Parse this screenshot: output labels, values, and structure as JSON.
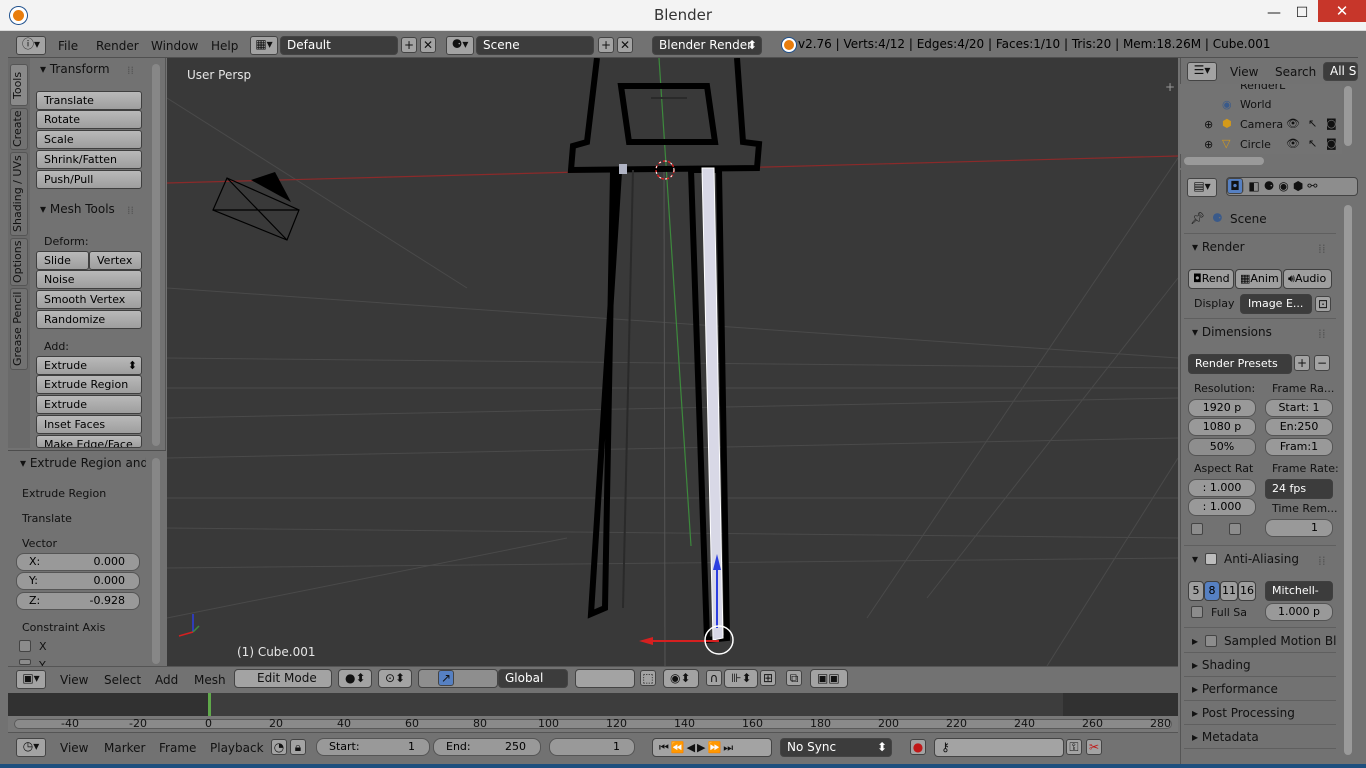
{
  "window": {
    "title": "Blender",
    "min": "—",
    "max": "☐",
    "close": "✕"
  },
  "menubar": {
    "items": [
      "File",
      "Render",
      "Window",
      "Help"
    ]
  },
  "screen_layout": "Default",
  "scene_name": "Scene",
  "render_engine": "Blender Render",
  "stats": "v2.76 | Verts:4/12 | Edges:4/20 | Faces:1/10 | Tris:20 | Mem:18.26M | Cube.001",
  "shelf_tabs": [
    "Tools",
    "Create",
    "Shading / UVs",
    "Options",
    "Grease Pencil"
  ],
  "transform": {
    "header": "Transform",
    "buttons": [
      "Translate",
      "Rotate",
      "Scale",
      "Shrink/Fatten",
      "Push/Pull"
    ]
  },
  "mesh_tools": {
    "header": "Mesh Tools",
    "deform_label": "Deform:",
    "slide_edge": "Slide Ed",
    "vertex": "Vertex",
    "deform_buttons": [
      "Noise",
      "Smooth Vertex",
      "Randomize"
    ],
    "add_label": "Add:",
    "extrude": "Extrude",
    "add_buttons": [
      "Extrude Region",
      "Extrude Individual",
      "Inset Faces",
      "Make Edge/Face"
    ]
  },
  "operator": {
    "header": "Extrude Region and",
    "lines": [
      "Extrude Region",
      "Translate"
    ],
    "vector_label": "Vector",
    "vector": [
      {
        "k": "X:",
        "v": "0.000"
      },
      {
        "k": "Y:",
        "v": "0.000"
      },
      {
        "k": "Z:",
        "v": "-0.928"
      }
    ],
    "constraint_label": "Constraint Axis",
    "axes": [
      "X",
      "Y"
    ]
  },
  "viewport": {
    "label": "User Persp",
    "object": "(1) Cube.001"
  },
  "vp_header": {
    "menus": [
      "View",
      "Select",
      "Add",
      "Mesh"
    ],
    "mode": "Edit Mode",
    "orientation": "Global"
  },
  "timeline": {
    "ticks": [
      "-40",
      "-20",
      "0",
      "20",
      "40",
      "60",
      "80",
      "100",
      "120",
      "140",
      "160",
      "180",
      "200",
      "220",
      "240",
      "260",
      "280"
    ]
  },
  "timeline_header": {
    "menus": [
      "View",
      "Marker",
      "Frame",
      "Playback"
    ],
    "start_label": "Start:",
    "start": "1",
    "end_label": "End:",
    "end": "250",
    "current": "1",
    "sync": "No Sync"
  },
  "outliner": {
    "menus": [
      "View",
      "Search"
    ],
    "filter": "All Sc",
    "items": [
      "RenderL",
      "World",
      "Camera",
      "Circle"
    ]
  },
  "properties": {
    "context": "Scene",
    "render_header": "Render",
    "render_buttons": [
      "Rend",
      "Anim",
      "Audio"
    ],
    "display_label": "Display",
    "display_value": "Image E...",
    "dimensions_header": "Dimensions",
    "presets": "Render Presets",
    "resolution_label": "Resolution:",
    "res_x": "1920 p",
    "res_y": "1080 p",
    "res_pct": "50%",
    "frame_range_label": "Frame Ra...",
    "frame_start": "Start: 1",
    "frame_end": "En:250",
    "frame_step": "Fram:1",
    "aspect_label": "Aspect Rat",
    "aspect_x": ": 1.000",
    "aspect_y": ": 1.000",
    "frame_rate_label": "Frame Rate:",
    "fps": "24 fps",
    "time_remap_label": "Time Rem...",
    "time_remap_value": "1",
    "aa_header": "Anti-Aliasing",
    "aa_samples": [
      "5",
      "8",
      "11",
      "16"
    ],
    "aa_filter": "Mitchell-",
    "full_sample": "Full Sa",
    "filter_size": "1.000 p",
    "collapsed": [
      "Sampled Motion Blur",
      "Shading",
      "Performance",
      "Post Processing",
      "Metadata"
    ]
  }
}
